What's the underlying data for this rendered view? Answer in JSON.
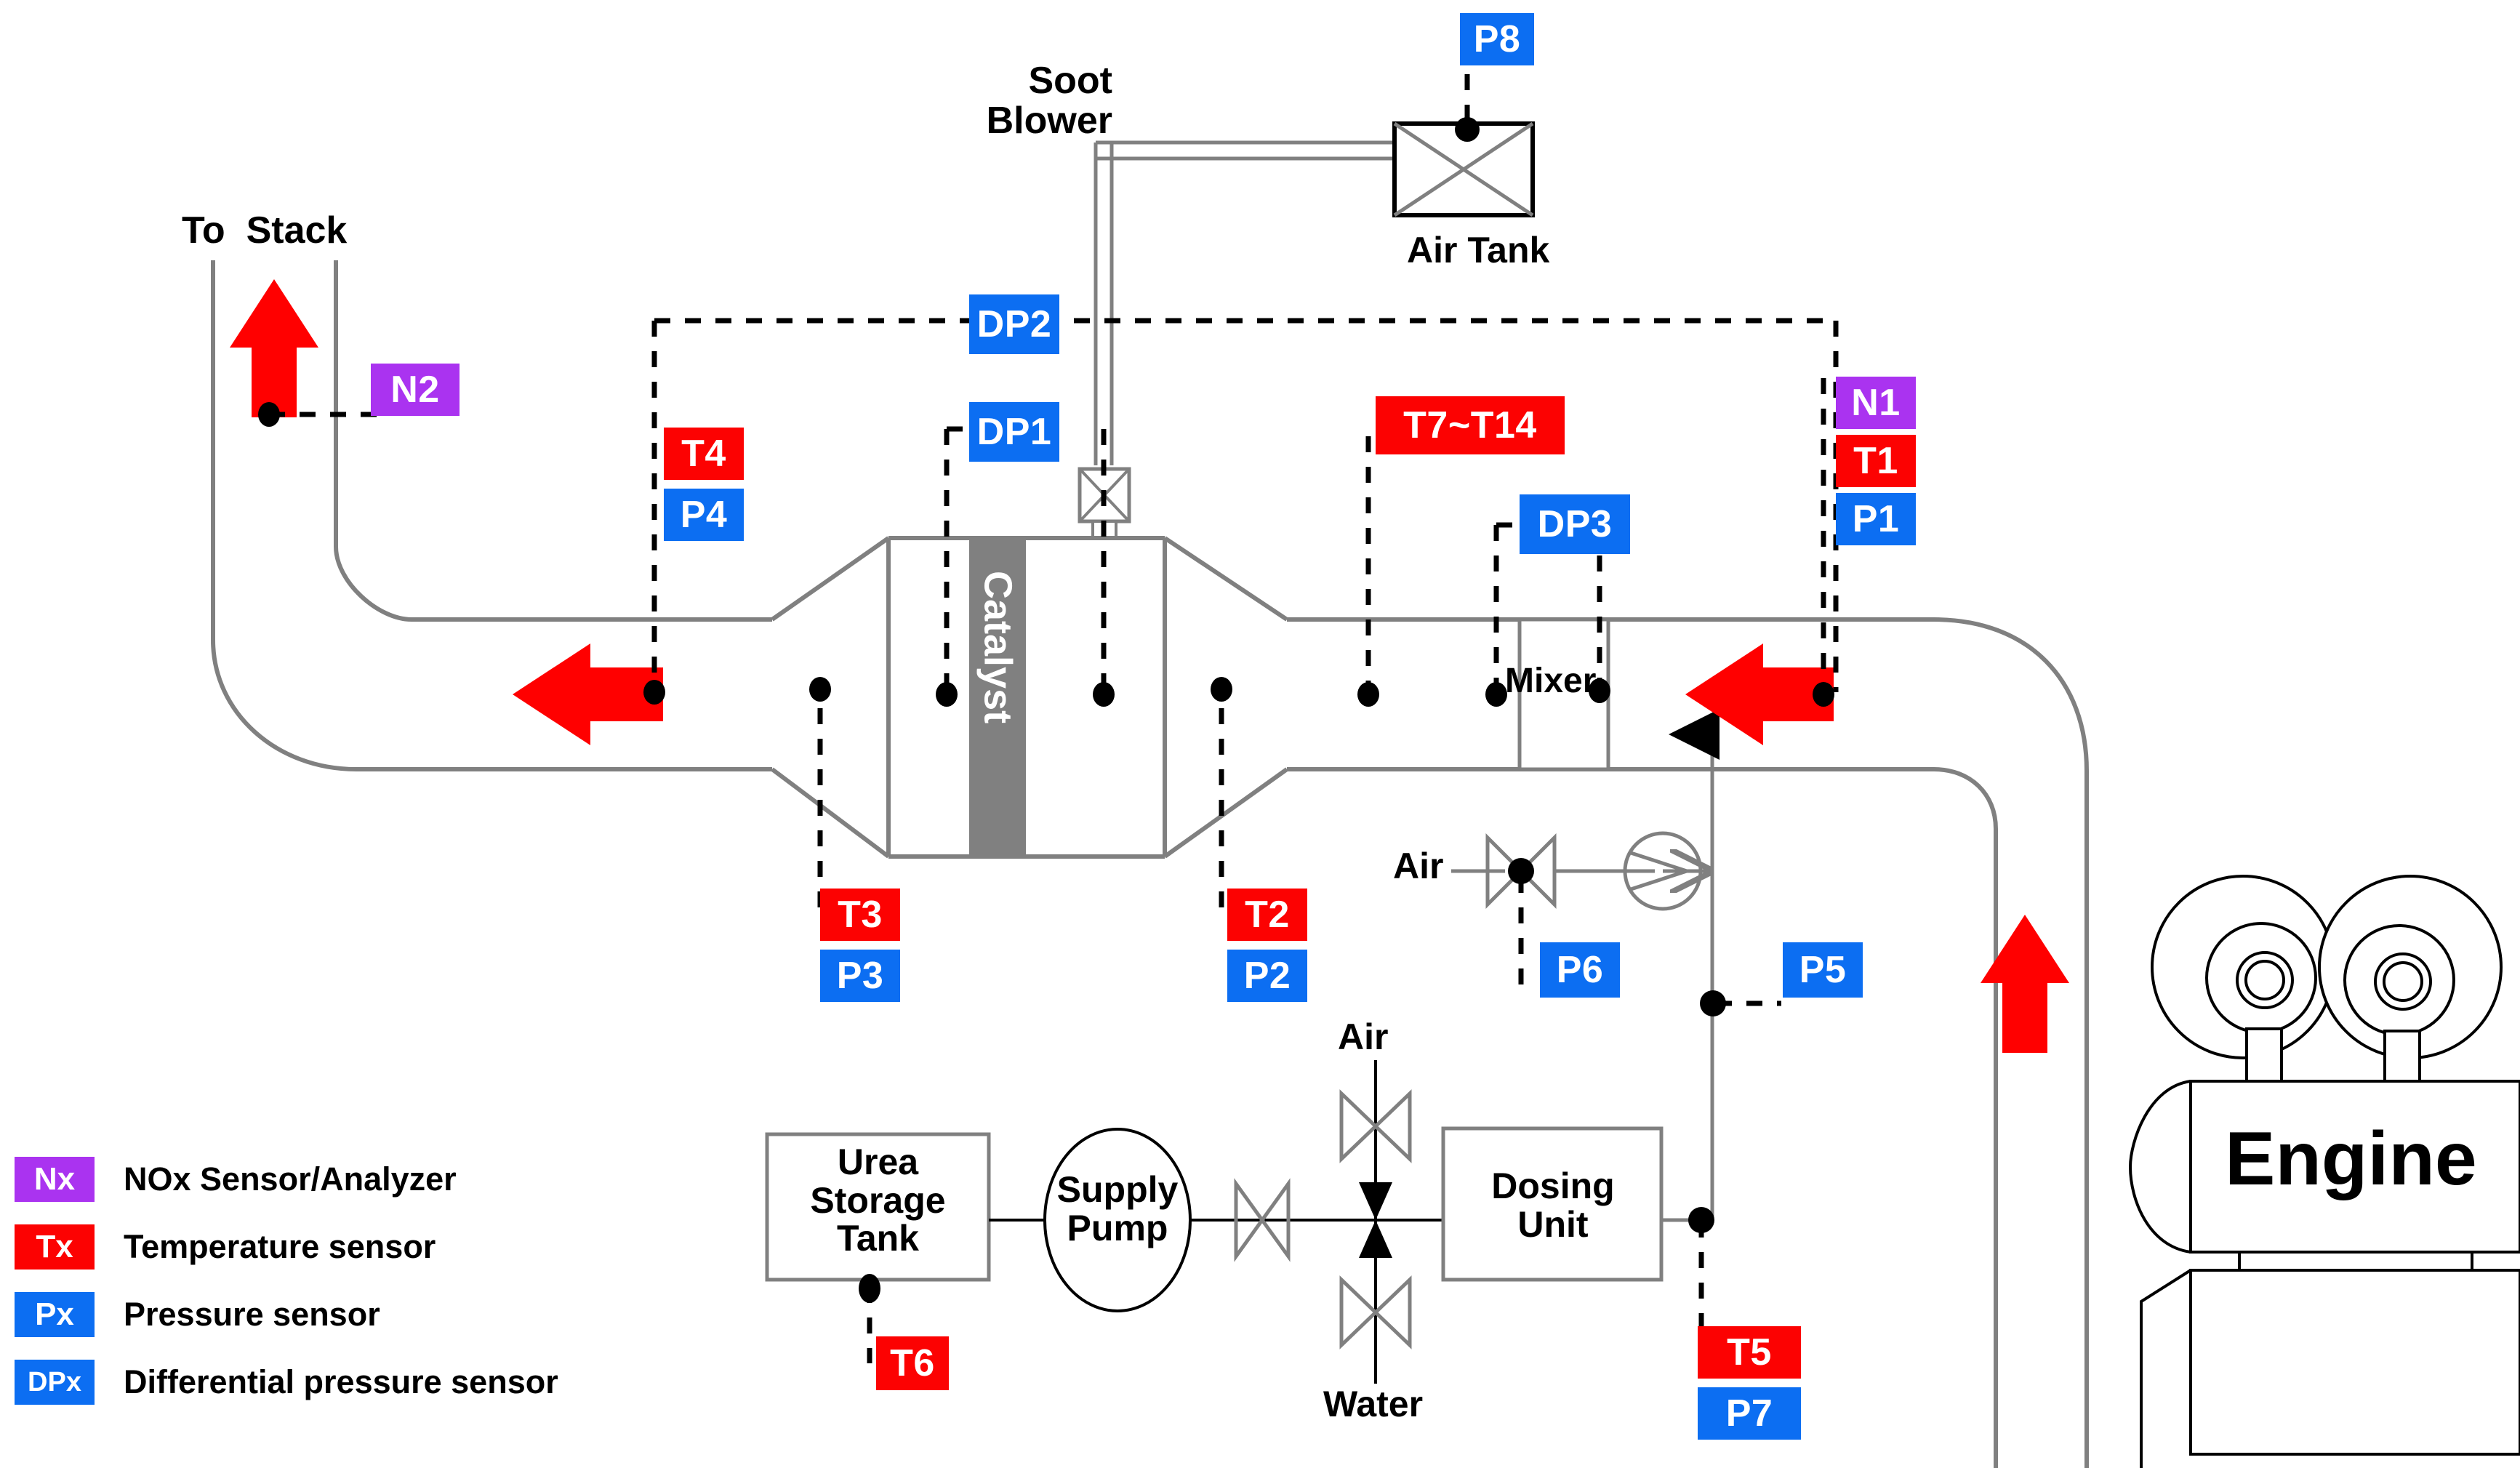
{
  "diagram": {
    "title": "Marine SCR (Selective Catalytic Reduction) system P&ID",
    "colors": {
      "nox": "#aa33f0",
      "temperature": "#fc0202",
      "pressure": "#0c6ef2",
      "flow_arrow": "#ff0000",
      "pipe": "#808080",
      "catalyst_bed": "#808080",
      "signal_line": "#000000"
    }
  },
  "equipment": {
    "to_stack": "To  Stack",
    "soot_blower": "Soot\nBlower",
    "air_tank": "Air Tank",
    "catalyst": "Catalyst",
    "mixer": "Mixer",
    "engine": "Engine",
    "urea_storage_tank": "Urea\nStorage\nTank",
    "supply_pump": "Supply\nPump",
    "dosing_unit": "Dosing\nUnit",
    "air_inlet_left": "Air",
    "air_inlet_vertical": "Air",
    "water_inlet": "Water"
  },
  "sensors": [
    {
      "id": "P8",
      "type": "p",
      "label": "P8"
    },
    {
      "id": "N2",
      "type": "n",
      "label": "N2"
    },
    {
      "id": "DP2",
      "type": "p",
      "label": "DP2"
    },
    {
      "id": "DP1",
      "type": "p",
      "label": "DP1"
    },
    {
      "id": "T4",
      "type": "t",
      "label": "T4"
    },
    {
      "id": "P4",
      "type": "p",
      "label": "P4"
    },
    {
      "id": "T7T14",
      "type": "t",
      "label": "T7~T14"
    },
    {
      "id": "DP3",
      "type": "p",
      "label": "DP3"
    },
    {
      "id": "N1",
      "type": "n",
      "label": "N1"
    },
    {
      "id": "T1",
      "type": "t",
      "label": "T1"
    },
    {
      "id": "P1",
      "type": "p",
      "label": "P1"
    },
    {
      "id": "T3",
      "type": "t",
      "label": "T3"
    },
    {
      "id": "P3",
      "type": "p",
      "label": "P3"
    },
    {
      "id": "T2",
      "type": "t",
      "label": "T2"
    },
    {
      "id": "P2",
      "type": "p",
      "label": "P2"
    },
    {
      "id": "P6",
      "type": "p",
      "label": "P6"
    },
    {
      "id": "P5",
      "type": "p",
      "label": "P5"
    },
    {
      "id": "T6",
      "type": "t",
      "label": "T6"
    },
    {
      "id": "T5",
      "type": "t",
      "label": "T5"
    },
    {
      "id": "P7",
      "type": "p",
      "label": "P7"
    }
  ],
  "legend": [
    {
      "chip": "Nx",
      "type": "n",
      "text": "NOx Sensor/Analyzer"
    },
    {
      "chip": "Tx",
      "type": "t",
      "text": "Temperature sensor"
    },
    {
      "chip": "Px",
      "type": "p",
      "text": "Pressure sensor"
    },
    {
      "chip": "DPx",
      "type": "p",
      "text": "Differential pressure sensor"
    }
  ]
}
